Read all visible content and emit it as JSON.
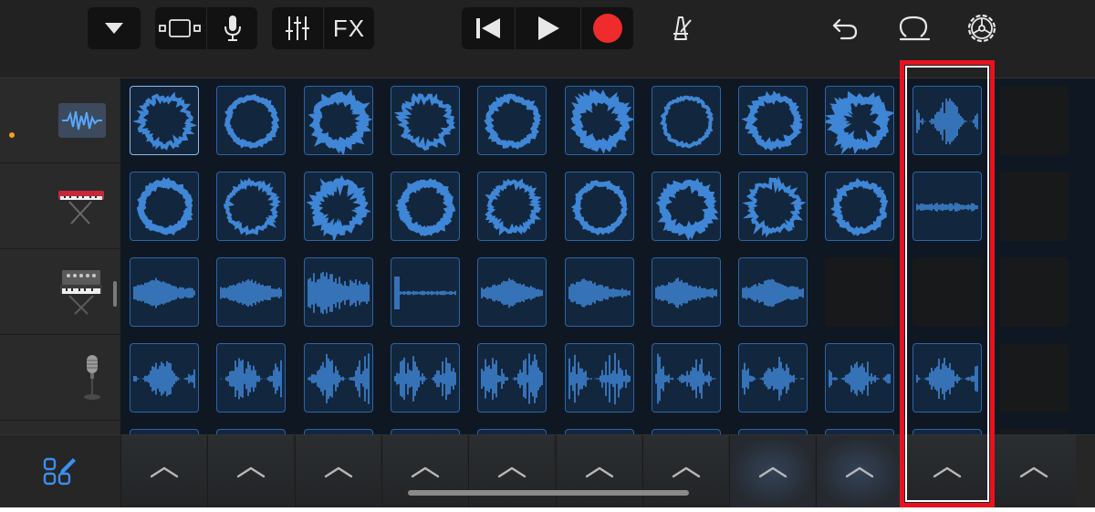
{
  "toolbar": {
    "fx_label": "FX",
    "accent_red": "#ef2b2b",
    "icons": [
      "chevron-down-icon",
      "view-toggle-icon",
      "microphone-icon",
      "mixer-icon",
      "rewind-icon",
      "play-icon",
      "record-icon",
      "metronome-icon",
      "undo-icon",
      "loop-icon",
      "settings-icon"
    ]
  },
  "tracks": [
    {
      "icon": "waveform-icon",
      "recording": true
    },
    {
      "icon": "keyboard-icon"
    },
    {
      "icon": "synth-icon"
    },
    {
      "icon": "microphone-stand-icon"
    }
  ],
  "grid": {
    "rows": [
      [
        "ring",
        "ring",
        "ring",
        "ring",
        "ring",
        "ring",
        "ring",
        "ring",
        "ring",
        "wave",
        "empty"
      ],
      [
        "ring",
        "ring",
        "ring",
        "ring",
        "ring",
        "ring",
        "ring",
        "ring",
        "ring",
        "flat",
        "empty"
      ],
      [
        "decay",
        "decay",
        "dense",
        "spike",
        "decay",
        "decay",
        "decay",
        "decay",
        "empty",
        "empty",
        "empty"
      ],
      [
        "wave",
        "wave",
        "wave",
        "wave",
        "wave",
        "wave",
        "wave",
        "wave",
        "wave",
        "wave",
        "empty"
      ]
    ],
    "selected_cell": "row-1-col-1",
    "clip_color": "#3f86d6"
  },
  "bottom_bar": {
    "triggers": 11,
    "lit_triggers": [
      7,
      8
    ]
  },
  "annotation": {
    "highlight_color": "#e8121f",
    "highlighted_column": 10
  }
}
